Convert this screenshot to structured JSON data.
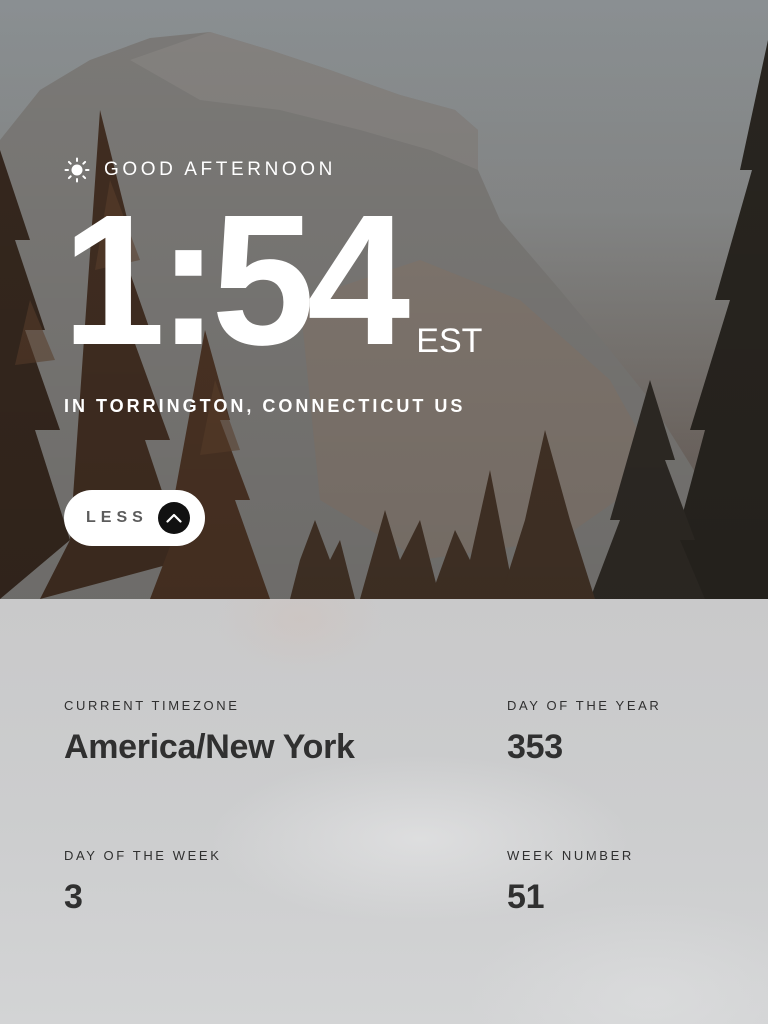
{
  "greeting": {
    "icon": "sun-icon",
    "text": "GOOD AFTERNOON"
  },
  "clock": {
    "time": "1:54",
    "abbreviation": "EST"
  },
  "location": "IN TORRINGTON, CONNECTICUT US",
  "toggle": {
    "label": "LESS",
    "icon": "chevron-up-icon"
  },
  "details": {
    "timezone": {
      "label": "CURRENT TIMEZONE",
      "value": "America/New York"
    },
    "day_of_year": {
      "label": "DAY OF THE YEAR",
      "value": "353"
    },
    "day_of_week": {
      "label": "DAY OF THE WEEK",
      "value": "3"
    },
    "week_number": {
      "label": "WEEK NUMBER",
      "value": "51"
    }
  },
  "colors": {
    "text_light": "#ffffff",
    "text_dark": "#303030",
    "button_bg": "#ffffff",
    "chevron_bg": "#111111"
  }
}
